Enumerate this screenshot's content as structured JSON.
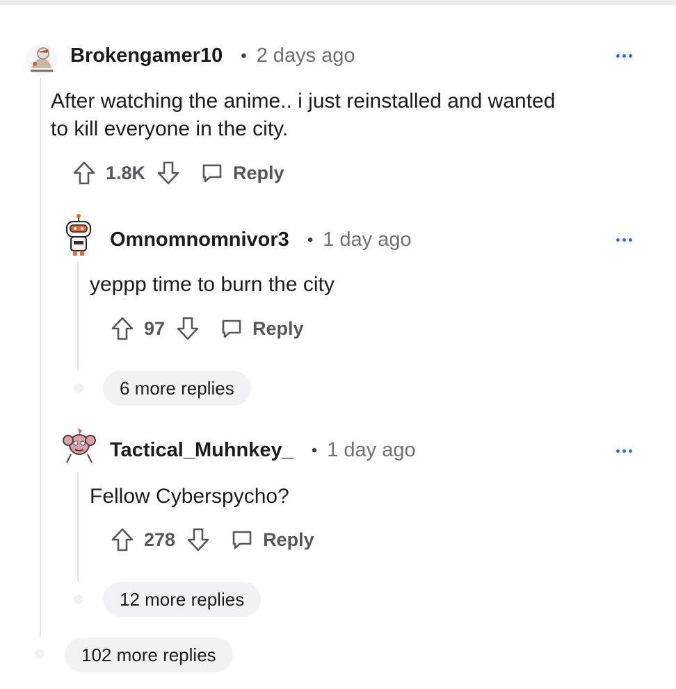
{
  "comments": [
    {
      "username": "Brokengamer10",
      "separator": "•",
      "time": "2 days ago",
      "body_lines": [
        "After watching the anime.. i just reinstalled and wanted",
        "to kill everyone in the city."
      ],
      "votes": "1.8K",
      "reply_label": "Reply",
      "avatar_icon": "avatar-sketch-icon"
    },
    {
      "username": "Omnomnomnivor3",
      "separator": "•",
      "time": "1 day ago",
      "body": "yeppp time to burn the city",
      "votes": "97",
      "reply_label": "Reply",
      "more_replies": "6 more replies",
      "avatar_icon": "avatar-robot-icon"
    },
    {
      "username": "Tactical_Muhnkey_",
      "separator": "•",
      "time": "1 day ago",
      "body": "Fellow Cyberspycho?",
      "votes": "278",
      "reply_label": "Reply",
      "more_replies": "12 more replies",
      "avatar_icon": "avatar-monkey-icon"
    }
  ],
  "thread_more_replies": "102 more replies",
  "colors": {
    "accent_dots": "#2f6fd0",
    "meta_gray": "#6d6f72",
    "action_gray": "#55575a",
    "pill_bg": "#f1f2f4",
    "thread_line": "#e2e3e6"
  }
}
